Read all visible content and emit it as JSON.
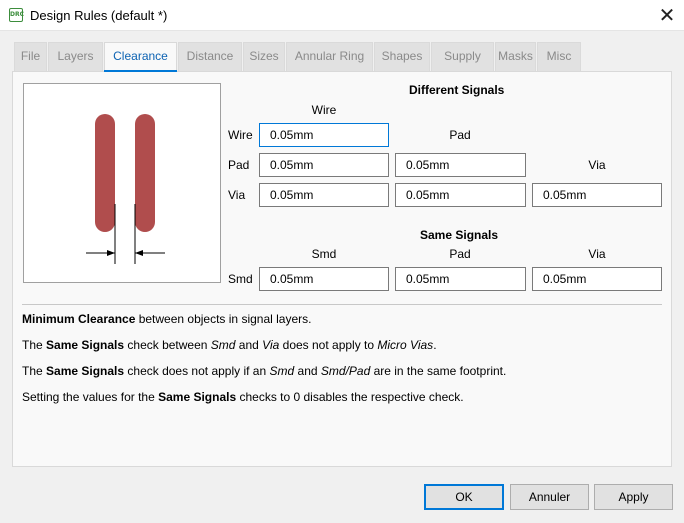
{
  "window": {
    "title": "Design Rules (default *)",
    "icon_text": "DRC",
    "close_glyph": "✕"
  },
  "tabs": [
    {
      "label": "File"
    },
    {
      "label": "Layers"
    },
    {
      "label": "Clearance"
    },
    {
      "label": "Distance"
    },
    {
      "label": "Sizes"
    },
    {
      "label": "Annular Ring"
    },
    {
      "label": "Shapes"
    },
    {
      "label": "Supply"
    },
    {
      "label": "Masks"
    },
    {
      "label": "Misc"
    }
  ],
  "active_tab": "Clearance",
  "different_signals": {
    "heading": "Different Signals",
    "col_wire": "Wire",
    "col_pad": "Pad",
    "col_via": "Via",
    "row_wire": "Wire",
    "row_pad": "Pad",
    "row_via": "Via",
    "wire_wire": "0.05mm",
    "pad_wire": "0.05mm",
    "pad_pad": "0.05mm",
    "via_wire": "0.05mm",
    "via_pad": "0.05mm",
    "via_via": "0.05mm"
  },
  "same_signals": {
    "heading": "Same Signals",
    "col_smd": "Smd",
    "col_pad": "Pad",
    "col_via": "Via",
    "row_smd": "Smd",
    "smd_smd": "0.05mm",
    "smd_pad": "0.05mm",
    "smd_via": "0.05mm"
  },
  "description": {
    "line1": {
      "b1": "Minimum Clearance",
      "t1": " between objects in signal layers."
    },
    "line2": {
      "t0": "The ",
      "b1": "Same Signals",
      "t1": " check between ",
      "i1": "Smd",
      "t2": " and ",
      "i2": "Via",
      "t3": " does not apply to ",
      "i3": "Micro Vias",
      "t4": "."
    },
    "line3": {
      "t0": "The ",
      "b1": "Same Signals",
      "t1": " check does not apply if an ",
      "i1": "Smd",
      "t2": " and ",
      "i2": "Smd/Pad",
      "t3": " are in the same footprint."
    },
    "line4": {
      "t0": "Setting the values for the ",
      "b1": "Same Signals",
      "t1": " checks to 0 disables the respective check."
    }
  },
  "buttons": {
    "ok": "OK",
    "cancel": "Annuler",
    "apply": "Apply"
  },
  "colors": {
    "trace": "#b04d4d",
    "accent": "#0078d7",
    "active_tab_text": "#0d63b3"
  }
}
